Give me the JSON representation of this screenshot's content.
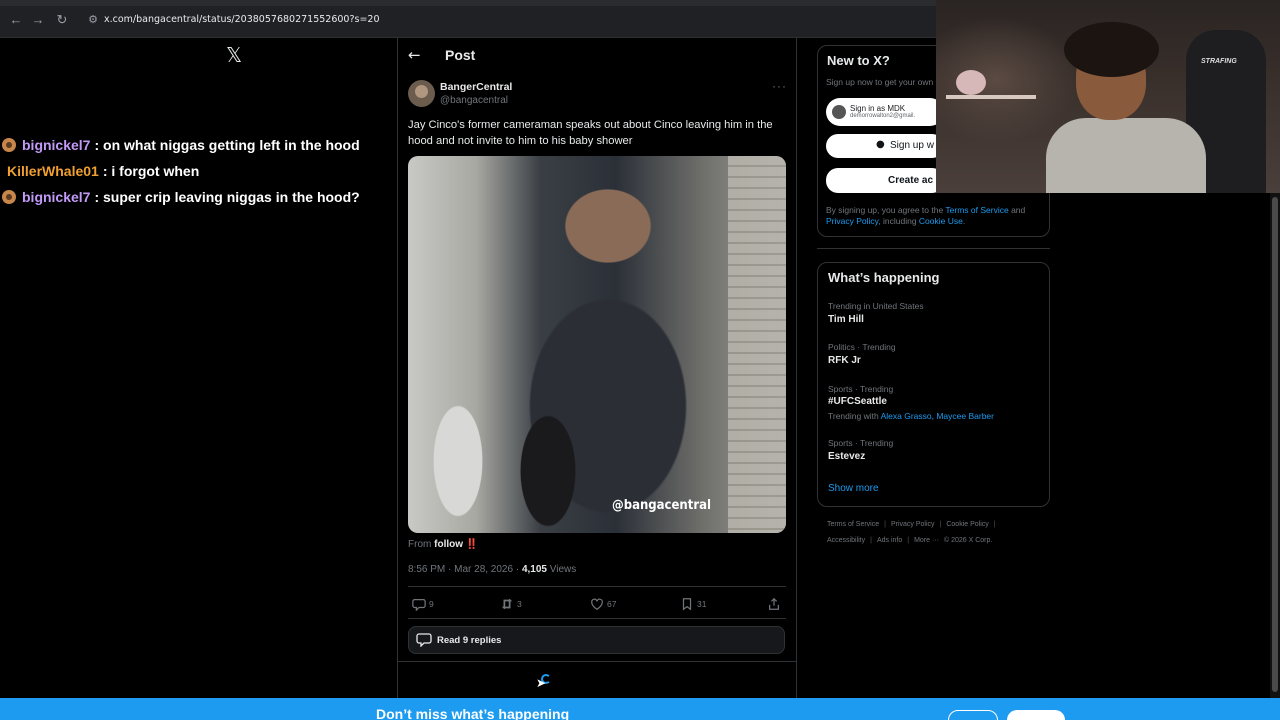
{
  "browser": {
    "url": "x.com/bangacentral/status/2038057680271552600?s=20",
    "back_icon": "arrow-left",
    "forward_icon": "arrow-right",
    "reload_icon": "reload"
  },
  "chat": {
    "messages": [
      {
        "user": "bignickel7",
        "text": ": on what niggas getting left in the hood",
        "badge": true
      },
      {
        "user": "KillerWhale01",
        "text": ": i forgot when",
        "badge": false
      },
      {
        "user": "bignickel7",
        "text": ": super crip leaving niggas in the hood?",
        "badge": true
      }
    ],
    "colors": {
      "purple": "#c29af7",
      "orange": "#f0a030"
    }
  },
  "post": {
    "header_title": "Post",
    "author_name": "BangerCentral",
    "author_handle": "@bangacentral",
    "text": "Jay Cinco's former cameraman speaks out about Cinco leaving him in the hood and not invite to him to his baby shower",
    "media_watermark": "@bangacentral",
    "from_prefix": "From",
    "from_name": "follow",
    "from_emoji": "‼️",
    "time": "8:56 PM · Mar 28, 2026 · ",
    "views_count": "4,105",
    "views_label": " Views",
    "actions": {
      "replies": "9",
      "reposts": "3",
      "likes": "67",
      "bookmarks": "31"
    },
    "read_replies": "Read 9 replies"
  },
  "sidebar": {
    "new_to_x": "New to X?",
    "signup_sub": "Sign up now to get your own",
    "google_name": "Sign in as MDK",
    "google_email": "demorrowalton2@gmail.",
    "apple_label": "Sign up w",
    "create_label": "Create ac",
    "terms_pre": "By signing up, you agree to the ",
    "terms_link": "Terms of Service",
    "terms_mid": " and ",
    "privacy_link": "Privacy Policy",
    "terms_mid2": ", including ",
    "cookie_link": "Cookie Use",
    "terms_end": ".",
    "whats_happening": "What’s happening",
    "trends": [
      {
        "category": "Trending in United States",
        "name": "Tim Hill"
      },
      {
        "category": "Politics · Trending",
        "name": "RFK Jr"
      },
      {
        "category": "Sports · Trending",
        "name": "#UFCSeattle",
        "with_prefix": "Trending with ",
        "with_links": "Alexa Grasso, Maycee Barber"
      },
      {
        "category": "Sports · Trending",
        "name": "Estevez"
      }
    ],
    "show_more": "Show more",
    "footer_row1": [
      "Terms of Service",
      "Privacy Policy",
      "Cookie Policy"
    ],
    "footer_row2": [
      "Accessibility",
      "Ads info",
      "More ···",
      "© 2026 X Corp."
    ]
  },
  "webcam": {
    "chair_label": "STRAFING"
  },
  "banner": {
    "text": "Don’t miss what’s happening"
  }
}
